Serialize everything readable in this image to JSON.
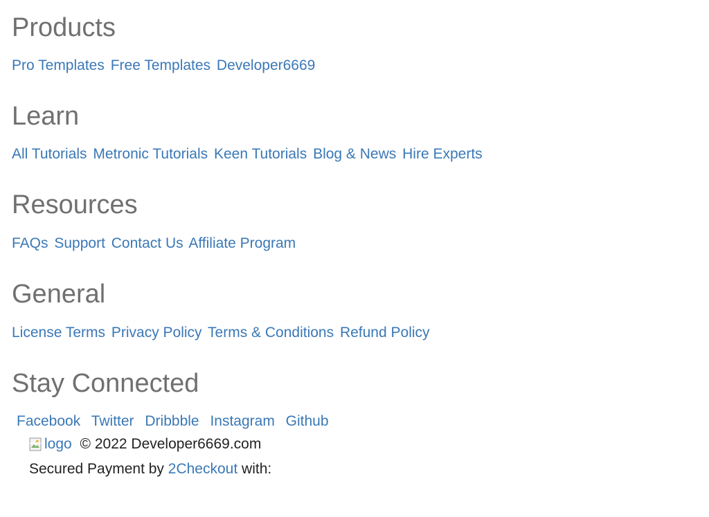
{
  "sections": [
    {
      "title": "Products",
      "links": [
        "Pro Templates",
        "Free Templates",
        "Developer6669"
      ]
    },
    {
      "title": "Learn",
      "links": [
        "All Tutorials",
        "Metronic Tutorials",
        "Keen Tutorials",
        "Blog & News",
        "Hire Experts"
      ]
    },
    {
      "title": "Resources",
      "links": [
        "FAQs",
        "Support",
        "Contact Us",
        "Affiliate Program"
      ]
    },
    {
      "title": "General",
      "links": [
        "License Terms",
        "Privacy Policy",
        "Terms & Conditions",
        "Refund Policy"
      ]
    },
    {
      "title": "Stay Connected",
      "links": []
    }
  ],
  "social": [
    "Facebook",
    "Twitter",
    "Dribbble",
    "Instagram",
    "Github"
  ],
  "footer": {
    "logo_alt": "logo",
    "copyright": "© 2022 Developer6669.com",
    "payment_prefix": "Secured Payment by ",
    "payment_link": "2Checkout",
    "payment_suffix": " with:"
  },
  "colors": {
    "heading": "#707070",
    "link": "#3a78b6",
    "text": "#222222",
    "background": "#ffffff"
  }
}
